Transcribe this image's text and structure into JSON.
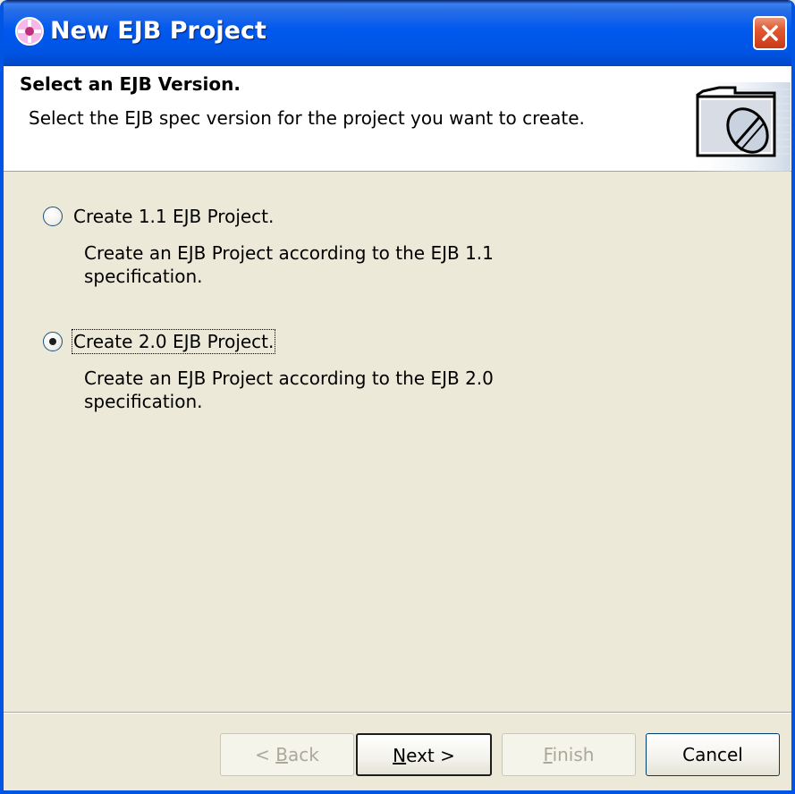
{
  "window": {
    "title": "New EJB Project"
  },
  "header": {
    "title": "Select an EJB Version.",
    "description": "Select the EJB spec version for the project you want to create."
  },
  "options": [
    {
      "label": "Create 1.1 EJB Project.",
      "checked": false,
      "description_lines": [
        "Create an EJB Project according to the EJB 1.1",
        "specification."
      ]
    },
    {
      "label": "Create 2.0 EJB Project.",
      "checked": true,
      "description_lines": [
        "Create an EJB Project according to the EJB 2.0",
        "specification."
      ]
    }
  ],
  "buttons": {
    "back": {
      "prefix": "< ",
      "mnemonic": "B",
      "rest": "ack",
      "enabled": false
    },
    "next": {
      "prefix": "",
      "mnemonic": "N",
      "rest": "ext >",
      "enabled": true
    },
    "finish": {
      "prefix": "",
      "mnemonic": "F",
      "rest": "inish",
      "enabled": false
    },
    "cancel": {
      "label": "Cancel",
      "enabled": true
    }
  },
  "icons": {
    "title": "app-icon",
    "close": "close-icon",
    "header": "ejb-jar-icon"
  },
  "colors": {
    "titlebar": "#0054e3",
    "close": "#e25b34",
    "body": "#ece9d8",
    "header": "#ffffff",
    "disabled_text": "#aca899"
  }
}
